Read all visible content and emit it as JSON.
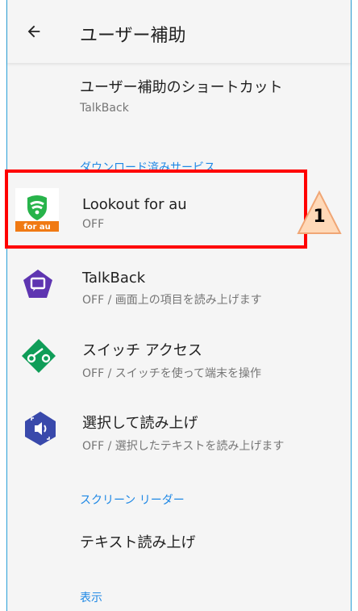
{
  "appbar": {
    "title": "ユーザー補助"
  },
  "items": {
    "shortcut": {
      "title": "ユーザー補助のショートカット",
      "subtitle": "TalkBack"
    },
    "downloaded_header": "ダウンロード済みサービス",
    "lookout": {
      "title": "Lookout for au",
      "subtitle": "OFF",
      "badge": "for au"
    },
    "talkback": {
      "title": "TalkBack",
      "subtitle": "OFF / 画面上の項目を読み上げます"
    },
    "switch_access": {
      "title": "スイッチ アクセス",
      "subtitle": "OFF / スイッチを使って端末を操作"
    },
    "select_to_speak": {
      "title": "選択して読み上げ",
      "subtitle": "OFF / 選択したテキストを読み上げます"
    },
    "screen_reader_header": "スクリーン リーダー",
    "tts": {
      "title": "テキスト読み上げ"
    },
    "display_header": "表示"
  },
  "annotation": {
    "number": "1"
  },
  "colors": {
    "accent": "#1e88e5",
    "highlight": "#ff0000",
    "talkback_icon": "#5e35b1",
    "switch_icon": "#0f9d58",
    "select_icon": "#3949ab"
  }
}
